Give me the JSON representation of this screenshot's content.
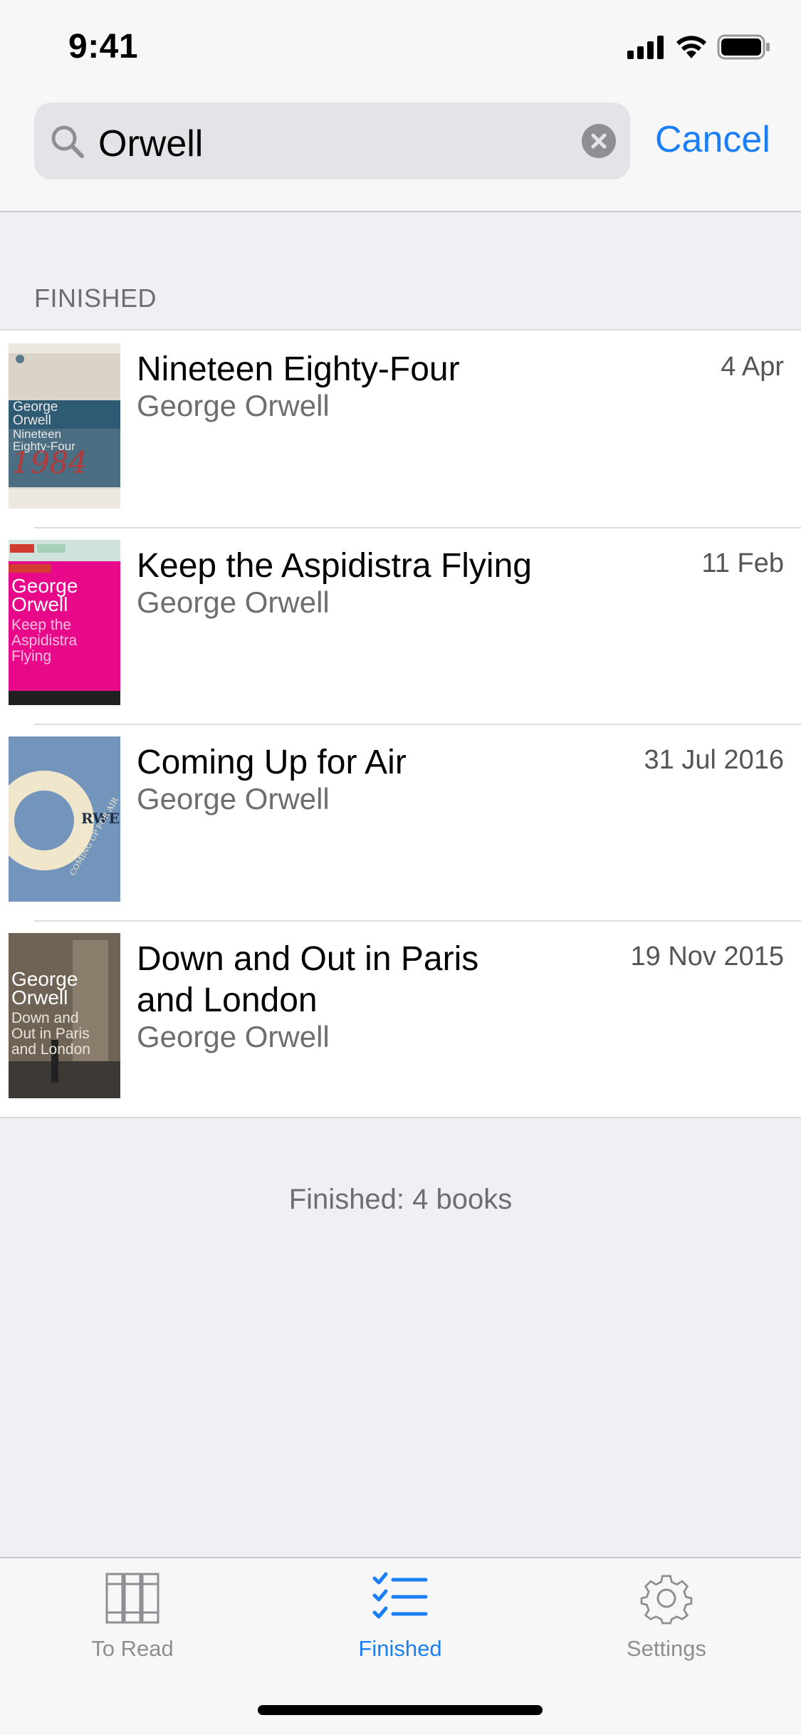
{
  "status_bar": {
    "time": "9:41"
  },
  "search": {
    "query": "Orwell",
    "cancel_label": "Cancel"
  },
  "section": {
    "header": "FINISHED"
  },
  "books": [
    {
      "title": "Nineteen Eighty-Four",
      "author": "George Orwell",
      "date": "4 Apr",
      "cover_text": [
        "George",
        "Orwell",
        "Nineteen",
        "Eighty-Four",
        "1984"
      ]
    },
    {
      "title": "Keep the Aspidistra Flying",
      "author": "George Orwell",
      "date": "11 Feb",
      "cover_text": [
        "George",
        "Orwell",
        "Keep the",
        "Aspidistra",
        "Flying"
      ]
    },
    {
      "title": "Coming Up for Air",
      "author": "George Orwell",
      "date": "31 Jul 2016",
      "cover_text": [
        "RWELL",
        "COMING UP FOR AIR"
      ]
    },
    {
      "title": "Down and Out in Paris and London",
      "author": "George Orwell",
      "date": "19 Nov 2015",
      "cover_text": [
        "George",
        "Orwell",
        "Down and",
        "Out in Paris",
        "and London"
      ]
    }
  ],
  "summary": "Finished: 4 books",
  "tabbar": {
    "tabs": [
      {
        "label": "To Read",
        "icon": "books-icon",
        "active": false
      },
      {
        "label": "Finished",
        "icon": "checklist-icon",
        "active": true
      },
      {
        "label": "Settings",
        "icon": "gear-icon",
        "active": false
      }
    ],
    "active_color": "#1a7ef4",
    "inactive_color": "#8e8e93"
  }
}
